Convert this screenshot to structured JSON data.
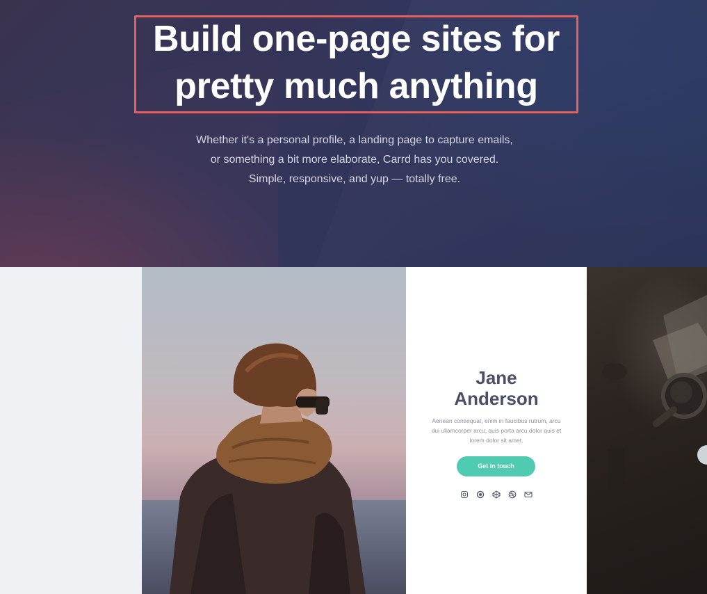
{
  "hero": {
    "headline_line1": "Build one-page sites for",
    "headline_line2": "pretty much anything",
    "subtext": [
      "Whether it's a personal profile, a landing page to capture emails,",
      "or something a bit more elaborate, Carrd has you covered.",
      "Simple, responsive, and yup — totally free."
    ],
    "highlight_color": "#e8605e"
  },
  "profile_card": {
    "name_line1": "Jane",
    "name_line2": "Anderson",
    "description": "Aenean consequat, enim in faucibus rutrum, arcu dui ullamcorper arcu, quis porta arcu dolor quis et lorem dolor sit amet.",
    "button_label": "Get in touch",
    "button_color": "#4ecbb0",
    "social_icons": [
      "instagram-icon",
      "circle-icon",
      "codepen-icon",
      "dribbble-icon",
      "email-icon"
    ]
  }
}
